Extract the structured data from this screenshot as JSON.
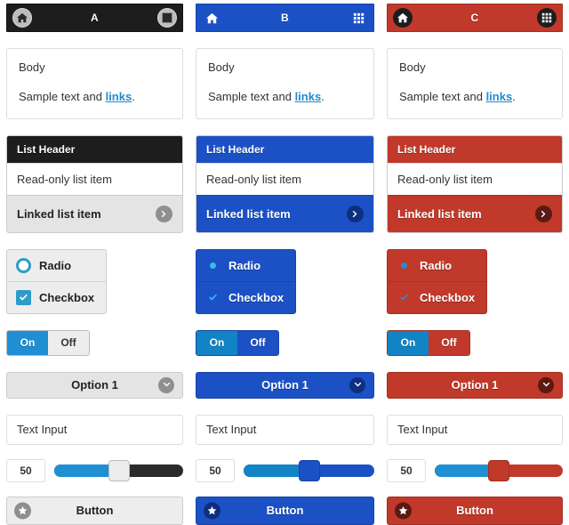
{
  "swatches": [
    {
      "id": "a",
      "header": {
        "title": "A",
        "home_icon": "home-icon",
        "grid_icon": "grid-icon",
        "bg_color": "#1d1d1d"
      },
      "body": {
        "heading": "Body",
        "text_before_link": "Sample text and ",
        "link_label": "links",
        "text_after_link": "."
      },
      "list": {
        "header_label": "List Header",
        "readonly_label": "Read-only list item",
        "linked_label": "Linked list item",
        "linked_icon": "chevron-right-icon"
      },
      "choices": {
        "radio_label": "Radio",
        "checkbox_label": "Checkbox",
        "radio_icon": "radio-selected-icon",
        "checkbox_icon": "checkmark-icon"
      },
      "toggle": {
        "on_label": "On",
        "off_label": "Off",
        "selected": "On"
      },
      "select": {
        "value": "Option 1",
        "chevron_icon": "chevron-down-icon"
      },
      "textinput": {
        "value": "Text Input",
        "placeholder": "Text Input"
      },
      "slider": {
        "value": "50",
        "percent": 50
      },
      "button": {
        "label": "Button",
        "icon": "star-icon"
      }
    },
    {
      "id": "b",
      "header": {
        "title": "B",
        "home_icon": "home-icon",
        "grid_icon": "grid-icon",
        "bg_color": "#1b51c5"
      },
      "body": {
        "heading": "Body",
        "text_before_link": "Sample text and ",
        "link_label": "links",
        "text_after_link": "."
      },
      "list": {
        "header_label": "List Header",
        "readonly_label": "Read-only list item",
        "linked_label": "Linked list item",
        "linked_icon": "chevron-right-icon"
      },
      "choices": {
        "radio_label": "Radio",
        "checkbox_label": "Checkbox",
        "radio_icon": "radio-selected-icon",
        "checkbox_icon": "checkmark-icon"
      },
      "toggle": {
        "on_label": "On",
        "off_label": "Off",
        "selected": "On"
      },
      "select": {
        "value": "Option 1",
        "chevron_icon": "chevron-down-icon"
      },
      "textinput": {
        "value": "Text Input",
        "placeholder": "Text Input"
      },
      "slider": {
        "value": "50",
        "percent": 50
      },
      "button": {
        "label": "Button",
        "icon": "star-icon"
      }
    },
    {
      "id": "c",
      "header": {
        "title": "C",
        "home_icon": "home-icon",
        "grid_icon": "grid-icon",
        "bg_color": "#c0392b"
      },
      "body": {
        "heading": "Body",
        "text_before_link": "Sample text and ",
        "link_label": "links",
        "text_after_link": "."
      },
      "list": {
        "header_label": "List Header",
        "readonly_label": "Read-only list item",
        "linked_label": "Linked list item",
        "linked_icon": "chevron-right-icon"
      },
      "choices": {
        "radio_label": "Radio",
        "checkbox_label": "Checkbox",
        "radio_icon": "radio-selected-icon",
        "checkbox_icon": "checkmark-icon"
      },
      "toggle": {
        "on_label": "On",
        "off_label": "Off",
        "selected": "On"
      },
      "select": {
        "value": "Option 1",
        "chevron_icon": "chevron-down-icon"
      },
      "textinput": {
        "value": "Text Input",
        "placeholder": "Text Input"
      },
      "slider": {
        "value": "50",
        "percent": 50
      },
      "button": {
        "label": "Button",
        "icon": "star-icon"
      }
    }
  ]
}
